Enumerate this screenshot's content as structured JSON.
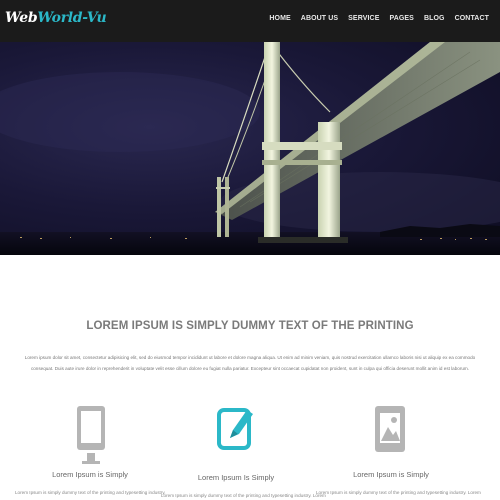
{
  "header": {
    "logo_part1": "Web",
    "logo_part2": "World-Vu",
    "menu": [
      {
        "label": "HOME"
      },
      {
        "label": "ABOUT US"
      },
      {
        "label": "SERVICE"
      },
      {
        "label": "PAGES"
      },
      {
        "label": "BLOG"
      },
      {
        "label": "CONTACT"
      }
    ]
  },
  "colors": {
    "nav_background": "#1b1b1b",
    "accent": "#2bb8c8",
    "icon_gray": "#b5b5b5"
  },
  "intro": {
    "headline": "LOREM IPSUM IS SIMPLY DUMMY TEXT OF THE PRINTING",
    "paragraph": "Lorem ipsum dolor sit amet, consectetur adipisicing elit, sed do eiusmod tempor incididunt ut labore et dolore magna aliqua. Ut enim ad minim veniam, quis nostrud exercitation ullamco laboris nisi ut aliquip ex ea commodo consequat. Duis aute irure dolor in reprehenderit in voluptate velit esse cillum dolore eu fugiat nulla pariatur. Excepteur sint occaecat cupidatat non proident, sunt in culpa qui officia deserunt mollit anim id est laborum."
  },
  "features": [
    {
      "icon": "tablet-icon",
      "title": "Lorem Ipsum is Simply",
      "description": "Lorem Ipsum is simply dummy text of the printing and typesetting industry."
    },
    {
      "icon": "edit-icon",
      "title": "Lorem Ipsum Is Simply",
      "description": "Lorem Ipsum is simply dummy text of the printing and typesetting industry. Lorem"
    },
    {
      "icon": "image-icon",
      "title": "Lorem Ipsum is Simply",
      "description": "Lorem Ipsum is simply dummy text of the printing and typesetting industry. Lorem"
    }
  ]
}
